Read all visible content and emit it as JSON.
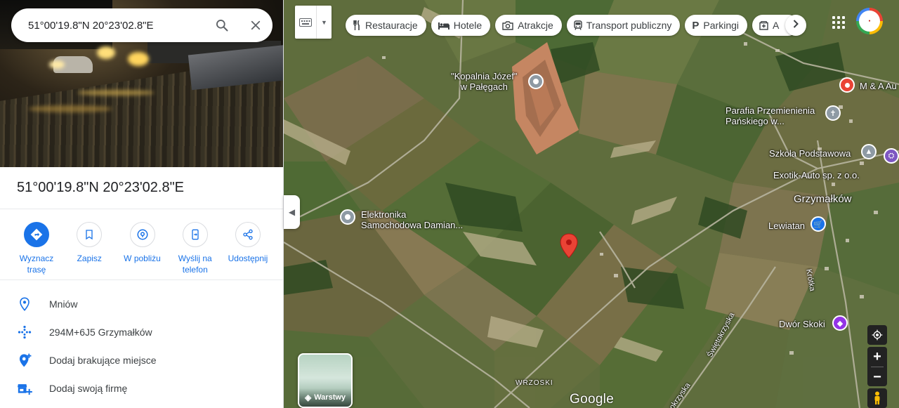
{
  "search": {
    "value": "51°00'19.8\"N 20°23'02.8\"E"
  },
  "place": {
    "title": "51°00'19.8\"N 20°23'02.8\"E"
  },
  "actions": [
    {
      "label": "Wyznacz trasę",
      "icon": "directions-icon"
    },
    {
      "label": "Zapisz",
      "icon": "bookmark-icon"
    },
    {
      "label": "W pobliżu",
      "icon": "nearby-icon"
    },
    {
      "label": "Wyślij na telefon",
      "icon": "send-to-phone-icon"
    },
    {
      "label": "Udostępnij",
      "icon": "share-icon"
    }
  ],
  "details": [
    {
      "text": "Mniów",
      "icon": "location-pin-icon"
    },
    {
      "text": "294M+6J5 Grzymałków",
      "icon": "plus-code-icon"
    },
    {
      "text": "Dodaj brakujące miejsce",
      "icon": "add-place-icon"
    },
    {
      "text": "Dodaj swoją firmę",
      "icon": "add-business-icon"
    }
  ],
  "chips": [
    {
      "label": "Restauracje",
      "icon": "restaurant-icon"
    },
    {
      "label": "Hotele",
      "icon": "hotel-icon"
    },
    {
      "label": "Atrakcje",
      "icon": "camera-icon"
    },
    {
      "label": "Transport publiczny",
      "icon": "transit-icon"
    },
    {
      "label": "Parkingi",
      "icon": "parking-icon"
    },
    {
      "label": "A",
      "icon": "pharmacy-icon"
    }
  ],
  "map_labels": {
    "kopalnia": "\"Kopalnia Józef\"\nw Pałęgach",
    "elektronika": "Elektronika\nSamochodowa Damian...",
    "parafia": "Parafia Przemienienia\nPańskiego w...",
    "szkola": "Szkoła Podstawowa",
    "exotik": "Exotik-Auto sp. z o.o.",
    "grzymalkow": "Grzymałków",
    "lewiatan": "Lewiatan",
    "ma_auto": "M & A Au",
    "dwor": "Dwór Skoki",
    "krotka": "Krótka",
    "swietokrzyska": "Świętokrzyska",
    "okrzyska": "okrzyska",
    "wrzoski": "WRZOSKI"
  },
  "layers": {
    "label": "Warstwy"
  },
  "google_logo": "Google",
  "colors": {
    "accent": "#1a73e8",
    "pin": "#ea4335",
    "poi_gray": "#8e9aa4",
    "poi_blue": "#1a73e8",
    "poi_purple": "#9334e6",
    "poi_red": "#ea4335"
  }
}
